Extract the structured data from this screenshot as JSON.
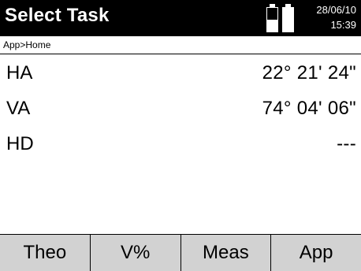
{
  "header": {
    "title": "Select Task",
    "icon": "battery-icon",
    "date": "28/06/10",
    "time": "15:39",
    "battery_levels": [
      0.5,
      1.0
    ]
  },
  "breadcrumb": "App>Home",
  "measurements": [
    {
      "label": "HA",
      "value": "22° 21' 24\""
    },
    {
      "label": "VA",
      "value": "74° 04' 06\""
    },
    {
      "label": "HD",
      "value": "---"
    }
  ],
  "softkeys": [
    "Theo",
    "V%",
    "Meas",
    "App"
  ],
  "colors": {
    "titlebar_bg": "#000000",
    "softkey_bg": "#d2d2d2",
    "text": "#000000"
  }
}
